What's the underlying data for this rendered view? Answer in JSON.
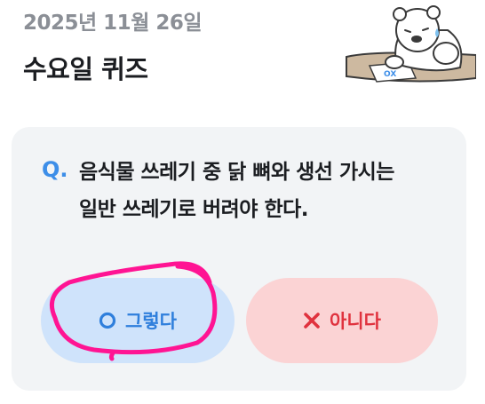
{
  "header": {
    "date": "2025년 11월 26일",
    "title": "수요일 퀴즈"
  },
  "mascot": {
    "icon": "bear-mascot-icon",
    "note_marks": "OX"
  },
  "quiz": {
    "q_mark": "Q.",
    "question_line1": "음식물 쓰레기 중 닭 뼈와 생선 가시는",
    "question_line2": "일반 쓰레기로 버려야 한다.",
    "answer_yes": {
      "label": "그렇다",
      "icon": "circle-o-icon",
      "color": "#2f7fdc"
    },
    "answer_no": {
      "label": "아니다",
      "icon": "x-mark-icon",
      "color": "#e0323e"
    }
  },
  "annotation": {
    "icon": "hand-drawn-circle",
    "color": "#ff1493"
  }
}
